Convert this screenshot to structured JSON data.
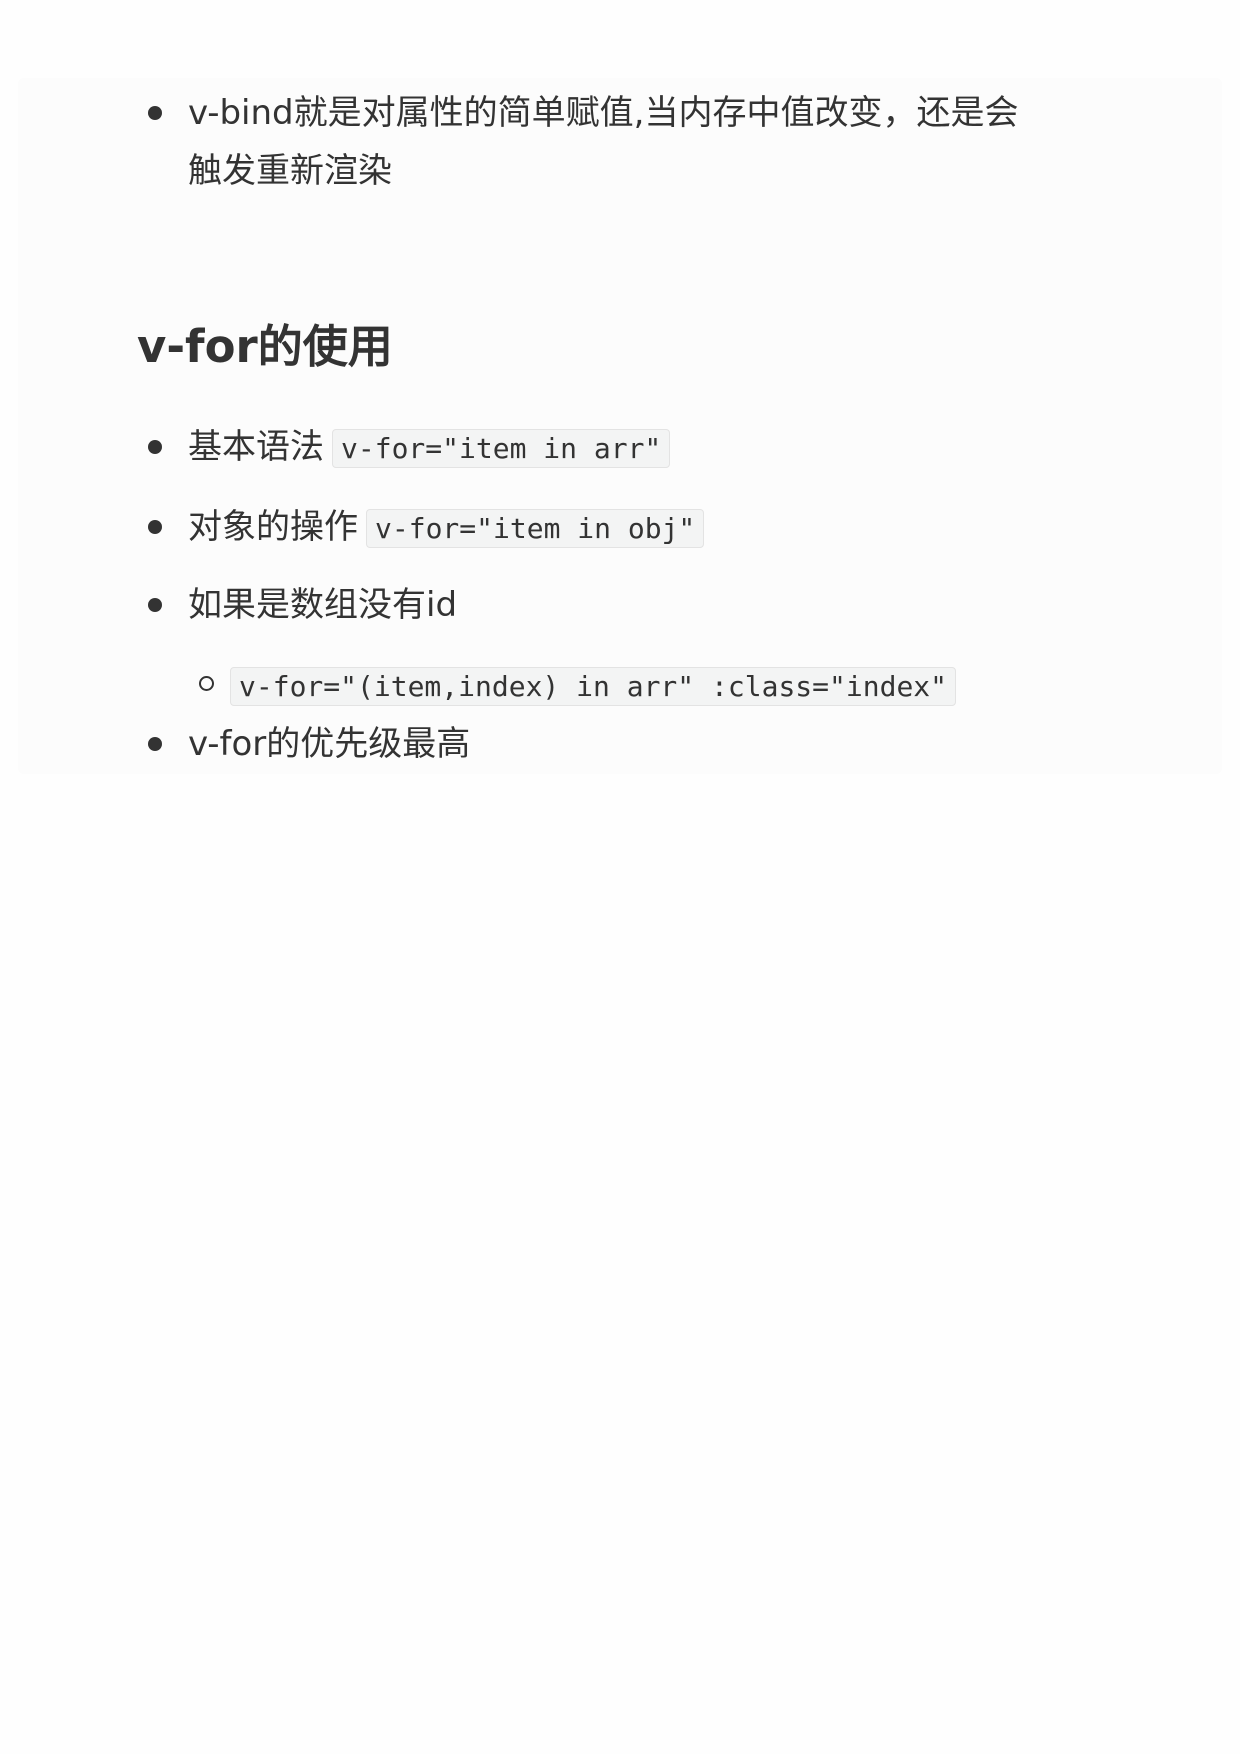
{
  "intro_item": {
    "line1": "v-bind就是对属性的简单赋值,当内存中值改变，还是会",
    "line2": "触发重新渲染"
  },
  "heading": "v-for的使用",
  "items": [
    {
      "text": "基本语法",
      "code": "v-for=\"item in arr\""
    },
    {
      "text": "对象的操作",
      "code": "v-for=\"item in obj\""
    },
    {
      "text": "如果是数组没有id"
    },
    {
      "text": "v-for的优先级最高"
    }
  ],
  "sub_item": {
    "code": "v-for=\"(item,index) in arr\" :class=\"index\""
  }
}
